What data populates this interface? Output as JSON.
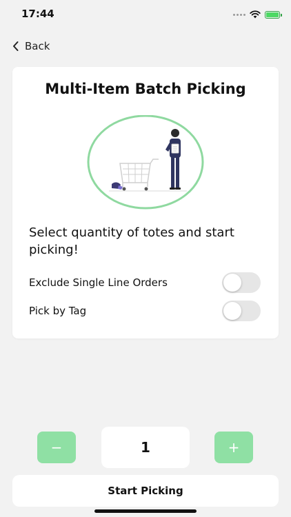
{
  "status_bar": {
    "time": "17:44",
    "icons": [
      "signal-dots-icon",
      "wifi-icon",
      "battery-charging-icon"
    ]
  },
  "nav": {
    "back_label": "Back",
    "back_icon": "chevron-left-icon"
  },
  "card": {
    "title": "Multi-Item Batch Picking",
    "illustration": "person-with-shopping-cart-illustration",
    "instructions": "Select quantity of totes and start picking!",
    "toggles": [
      {
        "label": "Exclude Single Line Orders",
        "on": false
      },
      {
        "label": "Pick by Tag",
        "on": false
      }
    ]
  },
  "stepper": {
    "decrement_label": "−",
    "increment_label": "+",
    "value": "1"
  },
  "primary_action": {
    "label": "Start Picking"
  },
  "colors": {
    "background": "#f2f2f2",
    "card": "#ffffff",
    "accent_green": "#8fe0a4",
    "illustration_ring": "#8fd9a0",
    "toggle_off": "#e6e6e6"
  }
}
